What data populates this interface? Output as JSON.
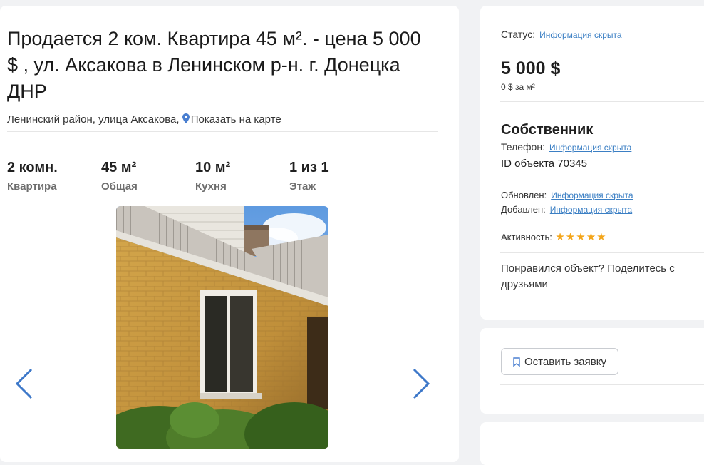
{
  "listing": {
    "title": "Продается 2 ком. Квартира 45 м². - цена 5 000 $ , ул. Аксакова в Ленинском р-н. г. Донецка ДНР",
    "address": "Ленинский район, улица Аксакова,",
    "map_link": "Показать на карте",
    "specs": [
      {
        "value": "2 комн.",
        "label": "Квартира"
      },
      {
        "value": "45 м²",
        "label": "Общая"
      },
      {
        "value": "10 м²",
        "label": "Кухня"
      },
      {
        "value": "1 из 1",
        "label": "Этаж"
      }
    ]
  },
  "sidebar": {
    "status_label": "Статус:",
    "hidden": "Информация скрыта",
    "price": "5 000 $",
    "price_per_m2": "0 $ за м²",
    "owner": "Собственник",
    "phone_label": "Телефон:",
    "object_id": "ID объекта 70345",
    "updated_label": "Обновлен:",
    "added_label": "Добавлен:",
    "activity_label": "Активность:",
    "activity_stars": 5,
    "share_text": "Понравился объект? Поделитесь с друзьями"
  },
  "request": {
    "button_label": "Оставить заявку"
  },
  "icons": {
    "map": "map-pin-icon",
    "bookmark": "bookmark-icon",
    "prev": "chevron-left-icon",
    "next": "chevron-right-icon",
    "star": "star-icon"
  },
  "colors": {
    "link": "#3b7fc4",
    "star": "#f3a51a",
    "arrow": "#3d78c9"
  }
}
